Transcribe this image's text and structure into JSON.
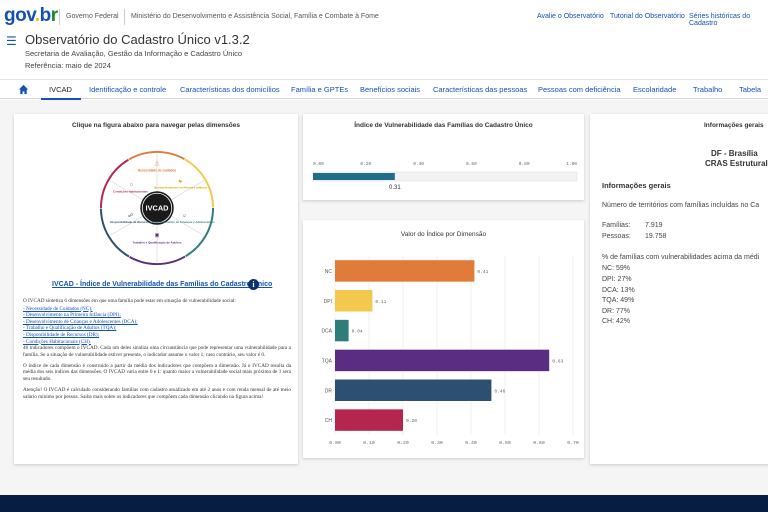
{
  "gov_bar": {
    "logo": [
      "gov",
      ".",
      "b",
      "r"
    ],
    "org1": "Governo Federal",
    "org2": "Ministério do Desenvolvimento e Assistência Social, Família e Combate à Fome",
    "links": [
      "Avalie o Observatório",
      "Tutorial do Observatório",
      "Séries históricas do Cadastro"
    ]
  },
  "app": {
    "title": "Observatório do Cadastro Único v1.3.2",
    "subtitle": "Secretaria de Avaliação, Gestão da Informação e Cadastro Único",
    "reference": "Referência: maio de 2024"
  },
  "tabs": [
    "IVCAD",
    "Identificação e controle",
    "Características dos domicílios",
    "Família e GPTEs",
    "Benefícios sociais",
    "Características das pessoas",
    "Pessoas com deficiência",
    "Escolaridade",
    "Trabalho",
    "Tabela"
  ],
  "left_card": {
    "title": "Clique na figura abaixo para navegar pelas dimensões",
    "wheel_center": "IVCAD",
    "wheel_labels": [
      "Necessidade de cuidados",
      "Desenvolvimento na Primeira Infância",
      "Desenvolvimento de Crianças e Adolescentes",
      "Trabalho e Qualificação de Adultos",
      "Disponibilidade de Recursos",
      "Condições Habitacionais"
    ],
    "link_title": "IVCAD - Índice de Vulnerabilidade das Famílias do Cadastro Único",
    "intro": "O IVCAD sintetiza 6 dimensões em que uma família pode estar em situação de vulnerabilidade social:",
    "dims": [
      "- Necessidade de Cuidados (NC);",
      "- Desenvolvimento na Primeira Infância (DPI);",
      "- Desenvolvimento de Crianças e Adolescentes (DCA);",
      "- Trabalho e Qualificação de Adultos (TQA);",
      "- Disponibilidade de Recursos (DR);",
      "- Condições Habitacionais (CH)."
    ],
    "p1": "46 indicadores compõem o IVCAD. Cada um deles sinaliza uma circunstância que pode representar uma vulnerabilidade para a família. Se a situação de vulnerabilidade estiver presente, o indicador assume o valor 1, caso contrário, seu valor é 0.",
    "p2": "O índice de cada dimensão é construído a partir da média dos indicadores que compõem a dimensão. Já o IVCAD resulta da média dos seis índices das dimensões. O IVCAD varia entre 0 e 1: quanto maior a vulnerabilidade social mais próximo de 1 será seu resultado.",
    "p3": "Atenção! O IVCAD é calculado considerando famílias com cadastro atualizado em até 2 anos e com renda mensal de até meio salário mínimo por pessoa. Saiba mais sobre os indicadores que compõem cada dimensão clicando na figura acima!"
  },
  "gauge_card": {
    "title": "Índice de Vulnerabilidade das Famílias do Cadastro Único",
    "ticks": [
      "0.00",
      "0.20",
      "0.40",
      "0.60",
      "0.80",
      "1.00"
    ],
    "value": 0.31,
    "value_label": "0.31"
  },
  "chart_card": {
    "title": "Valor do Índice por Dimensão"
  },
  "chart_data": {
    "type": "bar",
    "orientation": "horizontal",
    "title": "Valor do Índice por Dimensão",
    "categories": [
      "NC",
      "DPI",
      "DCA",
      "TQA",
      "DR",
      "CH"
    ],
    "values": [
      0.41,
      0.11,
      0.04,
      0.63,
      0.46,
      0.2
    ],
    "labels": [
      "0.41",
      "0.11",
      "0.04",
      "0.63",
      "0.46",
      "0.20"
    ],
    "colors": [
      "#e07b39",
      "#f2c94c",
      "#2e7d7a",
      "#5b2d82",
      "#2c4f72",
      "#b5264f"
    ],
    "x_ticks": [
      "0.00",
      "0.10",
      "0.20",
      "0.30",
      "0.40",
      "0.50",
      "0.60",
      "0.70"
    ],
    "xlim": [
      0,
      0.7
    ],
    "grid": true
  },
  "right_card": {
    "title": "Informações gerais",
    "place": "DF - Brasília",
    "cras": "CRAS Estrutural",
    "section": "Informações gerais",
    "territories": "Número de territórios com famílias incluídas no Ca",
    "familias_label": "Famílias:",
    "familias_value": "7.919",
    "pessoas_label": "Pessoas:",
    "pessoas_value": "19.758",
    "pct_title": "% de famílias com vulnerabilidades acima da médi",
    "pcts": [
      "NC: 59%",
      "DPI: 27%",
      "DCA: 13%",
      "TQA: 49%",
      "DR: 77%",
      "CH: 42%"
    ]
  },
  "colors": {
    "brand_blue": "#1351b4",
    "footer": "#071d41",
    "gauge_fill": "#1f6e8c"
  }
}
